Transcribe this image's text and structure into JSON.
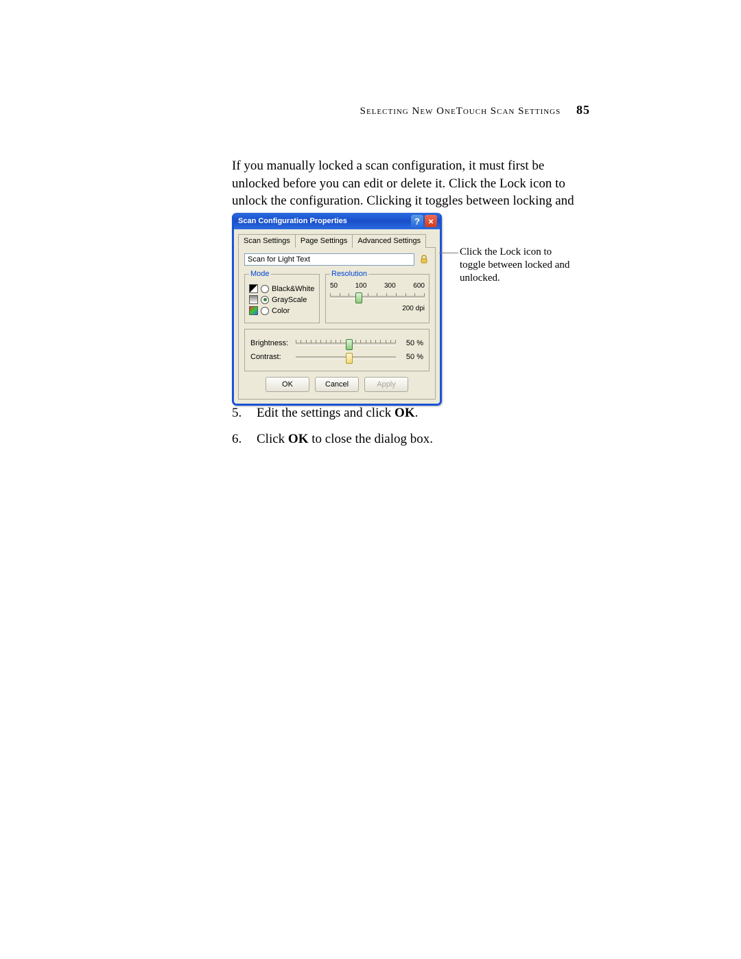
{
  "header": {
    "title": "Selecting New OneTouch Scan Settings",
    "page_number": "85"
  },
  "intro_paragraph": "If you manually locked a scan configuration, it must first be unlocked before you can edit or delete it. Click the Lock icon to unlock the configuration. Clicking it toggles between locking and unlocking the configuration.",
  "callout": "Click the Lock icon to toggle between locked and unlocked.",
  "dialog": {
    "title": "Scan Configuration Properties",
    "tabs": {
      "scan_settings": "Scan Settings",
      "page_settings": "Page Settings",
      "advanced_settings": "Advanced Settings"
    },
    "config_name": "Scan for Light Text",
    "mode": {
      "legend": "Mode",
      "black_white": "Black&White",
      "grayscale": "GrayScale",
      "color": "Color",
      "selected": "GrayScale"
    },
    "resolution": {
      "legend": "Resolution",
      "ticks": [
        "50",
        "100",
        "300",
        "600"
      ],
      "value_label": "200 dpi",
      "slider_percent": 27
    },
    "brightness": {
      "label": "Brightness:",
      "value_label": "50 %",
      "slider_percent": 50
    },
    "contrast": {
      "label": "Contrast:",
      "value_label": "50 %",
      "slider_percent": 50
    },
    "buttons": {
      "ok": "OK",
      "cancel": "Cancel",
      "apply": "Apply"
    }
  },
  "steps": {
    "step5_pre": "Edit the settings and click ",
    "step5_bold": "OK",
    "step5_post": ".",
    "step6_pre": "Click ",
    "step6_bold": "OK",
    "step6_post": " to close the dialog box."
  }
}
